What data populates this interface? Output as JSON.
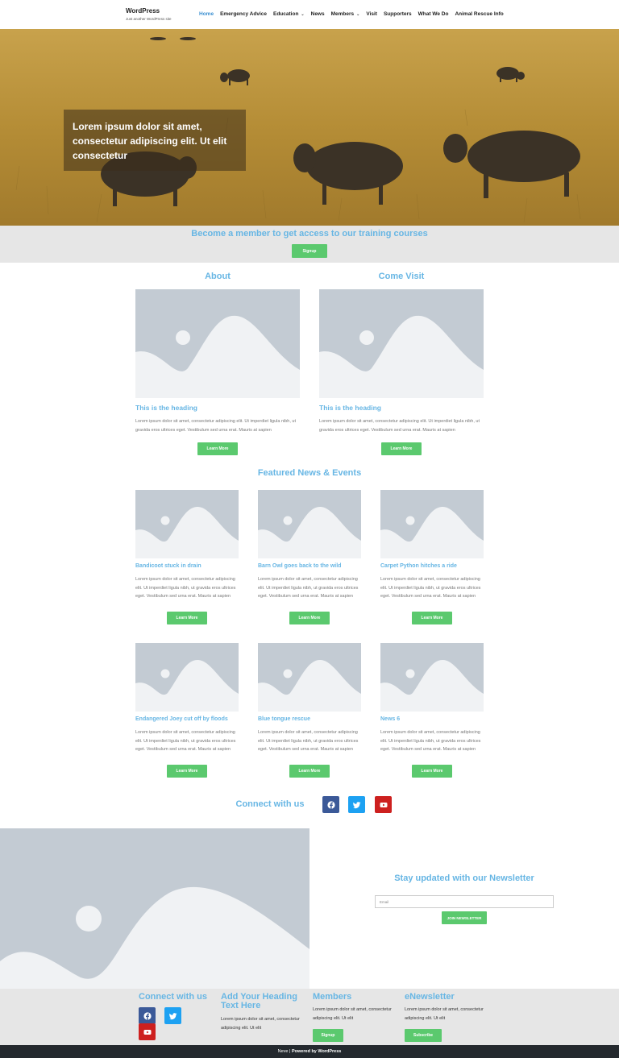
{
  "header": {
    "site_title": "WordPress",
    "tagline": "Just another WordPress site",
    "nav": [
      {
        "label": "Home",
        "active": true
      },
      {
        "label": "Emergency Advice"
      },
      {
        "label": "Education",
        "dropdown": true
      },
      {
        "label": "News"
      },
      {
        "label": "Members",
        "dropdown": true
      },
      {
        "label": "Visit"
      },
      {
        "label": "Supporters"
      },
      {
        "label": "What We Do"
      },
      {
        "label": "Animal Rescue Info"
      }
    ]
  },
  "hero": {
    "text": "Lorem ipsum dolor sit amet, consectetur adipiscing elit. Ut elit consectetur"
  },
  "member_band": {
    "text": "Become a member to get access to our training courses",
    "button": "Signup"
  },
  "about": {
    "title": "About",
    "heading": "This is the heading",
    "body": "Lorem ipsum dolor sit amet, consectetur adipiscing elit. Ut imperdiet ligula nibh, ut gravida eros ultrices eget. Vestibulum sed urna erat. Mauris at sapien",
    "button": "Learn More"
  },
  "visit": {
    "title": "Come Visit",
    "heading": "This is the heading",
    "body": "Lorem ipsum dolor sit amet, consectetur adipiscing elit. Ut imperdiet ligula nibh, ut gravida eros ultrices eget. Vestibulum sed urna erat. Mauris at sapien",
    "button": "Learn More"
  },
  "news": {
    "title": "Featured News & Events",
    "body": "Lorem ipsum dolor sit amet, consectetur adipiscing elit. Ut imperdiet ligula nibh, ut gravida eros ultrices eget. Vestibulum sed urna erat. Mauris at sapien",
    "button": "Learn More",
    "items": [
      {
        "title": "Bandicoot stuck in drain"
      },
      {
        "title": "Barn Owl goes back to the wild"
      },
      {
        "title": "Carpet Python hitches a ride"
      },
      {
        "title": "Endangered Joey cut off by floods"
      },
      {
        "title": "Blue tongue rescue"
      },
      {
        "title": "News 6"
      }
    ]
  },
  "connect": {
    "label": "Connect with us",
    "icons": [
      "facebook-icon",
      "twitter-icon",
      "youtube-icon"
    ]
  },
  "newsletter": {
    "title": "Stay updated with our Newsletter",
    "placeholder": "Email",
    "button": "JOIN NEWSLETTER"
  },
  "footer": {
    "col1_title": "Connect with us",
    "col2_title": "Add Your Heading Text Here",
    "col2_body": "Lorem ipsum dolor sit amet, consectetur adipiscing elit. Ut elit",
    "col3_title": "Members",
    "col3_body": "Lorem ipsum dolor sit amet, consectetur adipiscing elit. Ut elit",
    "col3_button": "Signup",
    "col4_title": "eNewsletter",
    "col4_body": "Lorem ipsum dolor sit amet, consectetur adipiscing elit. Ut elit",
    "col4_button": "Subscribe"
  },
  "bottom_bar": {
    "theme": "Neve",
    "separator": " | ",
    "powered": "Powered by WordPress"
  },
  "colors": {
    "accent": "#67b6e4",
    "button": "#5bc96e",
    "placeholder": "#c3cbd3",
    "band": "#e6e6e6",
    "facebook": "#3b5998",
    "twitter": "#1da1f2",
    "youtube": "#cd201f"
  }
}
